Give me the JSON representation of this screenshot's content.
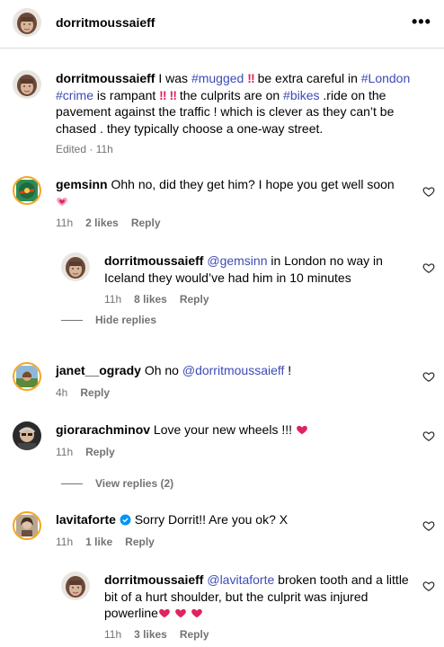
{
  "post": {
    "author": "dorritmoussaieff",
    "more_label": "•••"
  },
  "caption": {
    "username": "dorritmoussaieff",
    "t1": " I was ",
    "tag_mugged": "#mugged",
    "t2": "  be extra careful in ",
    "tag_london": "#London",
    "tag_crime": "#crime",
    "t3": " is rampant ",
    "t4": "  the culprits are on ",
    "tag_bikes": "#bikes",
    "t5": " .ride on the pavement against the traffic ! which is clever as they can’t be chased . they typically choose a one-way street.",
    "bang": "‼",
    "meta": "Edited · 11h"
  },
  "comments": [
    {
      "username": "gemsinn",
      "text": " Ohh no, did they get him? I hope you get well soon",
      "time": "11h",
      "likes": "2 likes",
      "reply": "Reply"
    },
    {
      "username": "dorritmoussaieff",
      "mention": "@gemsinn",
      "text": " in London no way in Iceland they would’ve had him in 10 minutes",
      "time": "11h",
      "likes": "8 likes",
      "reply": "Reply"
    },
    {
      "username": "janet__ogrady",
      "text": " Oh no ",
      "mention": "@dorritmoussaieff",
      "text2": " !",
      "time": "4h",
      "reply": "Reply"
    },
    {
      "username": "giorarachminov",
      "text": " Love your new wheels !!! ",
      "time": "11h",
      "reply": "Reply"
    },
    {
      "username": "lavitaforte",
      "text": " Sorry Dorrit!! Are you ok? X",
      "time": "11h",
      "likes": "1 like",
      "reply": "Reply"
    },
    {
      "username": "dorritmoussaieff",
      "mention": "@lavitaforte",
      "text": " broken tooth and a little bit of a hurt shoulder, but the culprit was injured powerline",
      "time": "11h",
      "likes": "3 likes",
      "reply": "Reply"
    }
  ],
  "hide_replies": "Hide replies",
  "view_replies": "View replies (2)",
  "icons": {
    "more": "more-options-icon",
    "heart": "heart-outline-icon",
    "heart_emoji": "red-heart-emoji",
    "pink_heart": "growing-heart-emoji",
    "verified": "verified-badge-icon"
  },
  "colors": {
    "link": "#3d4bb5",
    "meta": "#737373",
    "divider": "#dbdbdb",
    "heart": "#e0245e"
  }
}
